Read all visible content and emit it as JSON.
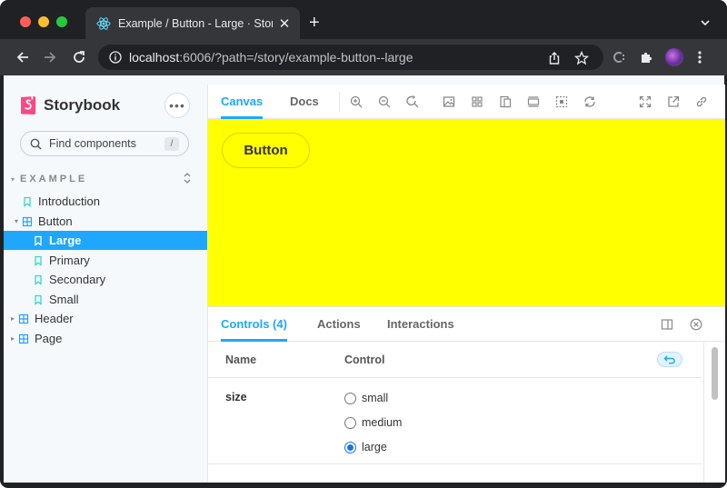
{
  "browser": {
    "tab_title": "Example / Button - Large · Storybook",
    "new_tab_symbol": "+",
    "close_symbol": "✕",
    "url_host": "localhost",
    "url_rest": ":6006/?path=/story/example-button--large"
  },
  "sidebar": {
    "brand": "Storybook",
    "menu_symbol": "•••",
    "search_placeholder": "Find components",
    "search_shortcut": "/",
    "group_title": "EXAMPLE",
    "items": [
      {
        "label": "Introduction",
        "icon": "bookmark-icon"
      },
      {
        "label": "Button",
        "icon": "component-icon",
        "expanded": true
      },
      {
        "label": "Large",
        "icon": "bookmark-icon",
        "selected": true
      },
      {
        "label": "Primary",
        "icon": "bookmark-icon"
      },
      {
        "label": "Secondary",
        "icon": "bookmark-icon"
      },
      {
        "label": "Small",
        "icon": "bookmark-icon"
      },
      {
        "label": "Header",
        "icon": "component-icon",
        "expanded": false
      },
      {
        "label": "Page",
        "icon": "component-icon",
        "expanded": false
      }
    ]
  },
  "toolbar": {
    "tabs": [
      "Canvas",
      "Docs"
    ],
    "active_tab": "Canvas"
  },
  "canvas": {
    "background": "#ffff00",
    "button_label": "Button"
  },
  "addons": {
    "tabs": [
      "Controls (4)",
      "Actions",
      "Interactions"
    ],
    "active_tab": "Controls (4)",
    "table": {
      "header_name": "Name",
      "header_control": "Control",
      "rows": [
        {
          "name": "size",
          "options": [
            "small",
            "medium",
            "large"
          ],
          "selected": "large"
        }
      ]
    }
  },
  "colors": {
    "accent": "#1ea7fd",
    "brand": "#ff4785",
    "canvas_bg": "#ffff00"
  }
}
